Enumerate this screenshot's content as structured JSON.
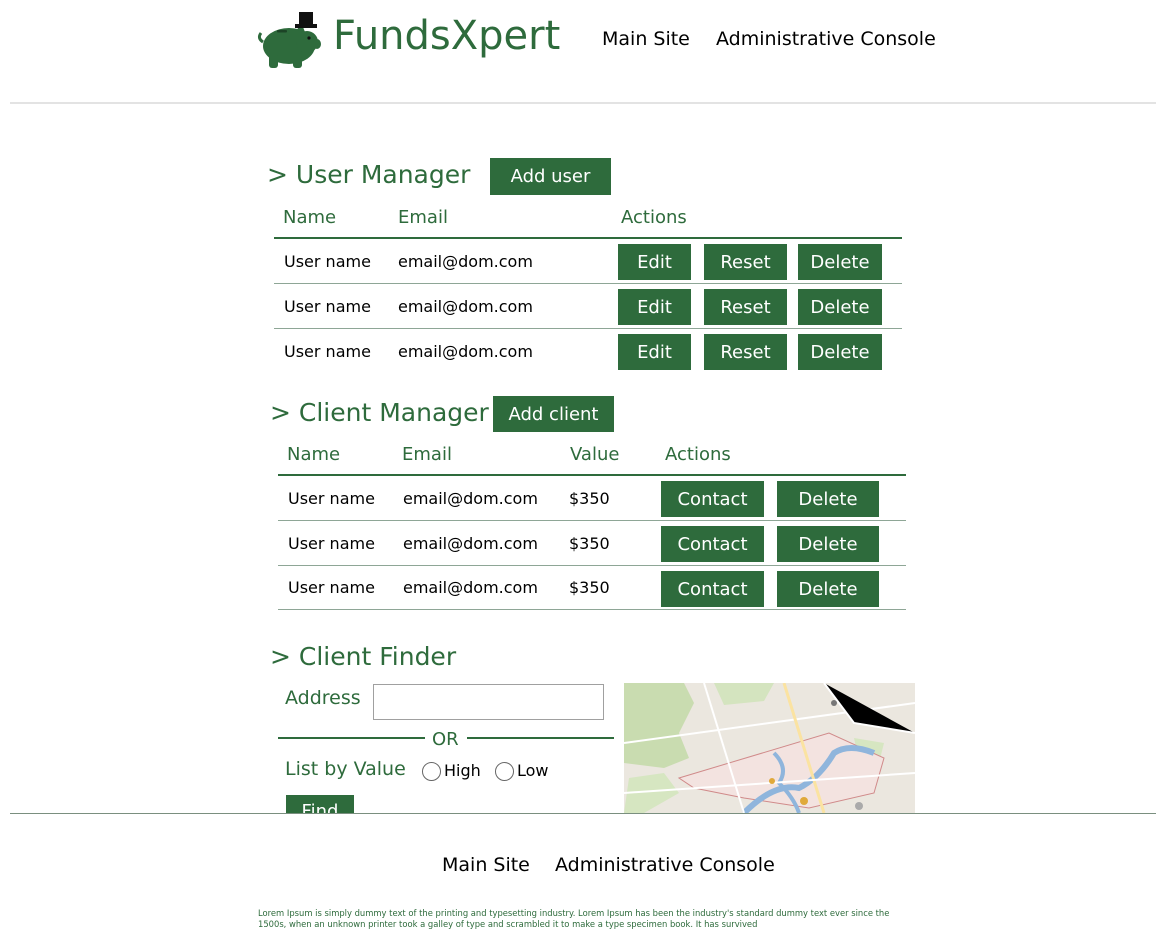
{
  "header": {
    "brand": "FundsXpert",
    "nav": {
      "main_site": "Main Site",
      "admin_console": "Administrative Console"
    }
  },
  "user_manager": {
    "title": "> User Manager",
    "add_label": "Add user",
    "columns": {
      "name": "Name",
      "email": "Email",
      "actions": "Actions"
    },
    "rows": [
      {
        "name": "User name",
        "email": "email@dom.com"
      },
      {
        "name": "User name",
        "email": "email@dom.com"
      },
      {
        "name": "User name",
        "email": "email@dom.com"
      }
    ],
    "actions": {
      "edit": "Edit",
      "reset": "Reset",
      "delete": "Delete"
    }
  },
  "client_manager": {
    "title": "> Client Manager",
    "add_label": "Add client",
    "columns": {
      "name": "Name",
      "email": "Email",
      "value": "Value",
      "actions": "Actions"
    },
    "rows": [
      {
        "name": "User name",
        "email": "email@dom.com",
        "value": "$350"
      },
      {
        "name": "User name",
        "email": "email@dom.com",
        "value": "$350"
      },
      {
        "name": "User name",
        "email": "email@dom.com",
        "value": "$350"
      }
    ],
    "actions": {
      "contact": "Contact",
      "delete": "Delete"
    }
  },
  "client_finder": {
    "title": "> Client Finder",
    "address_label": "Address",
    "address_value": "",
    "or_label": "OR",
    "list_by_value_label": "List by Value",
    "options": {
      "high": "High",
      "low": "Low"
    },
    "find_label": "Find",
    "map_icon": "map-thumbnail"
  },
  "footer": {
    "nav": {
      "main_site": "Main Site",
      "admin_console": "Administrative Console"
    },
    "lorem": "Lorem Ipsum is simply dummy text of the printing and typesetting industry. Lorem Ipsum has been the industry's standard dummy text ever since the 1500s, when an unknown printer took a galley of type and scrambled it to make a type specimen book. It has survived"
  },
  "colors": {
    "accent": "#2e6b3c",
    "divider": "#7a8f7f",
    "header_divider": "#e3e3e3"
  }
}
